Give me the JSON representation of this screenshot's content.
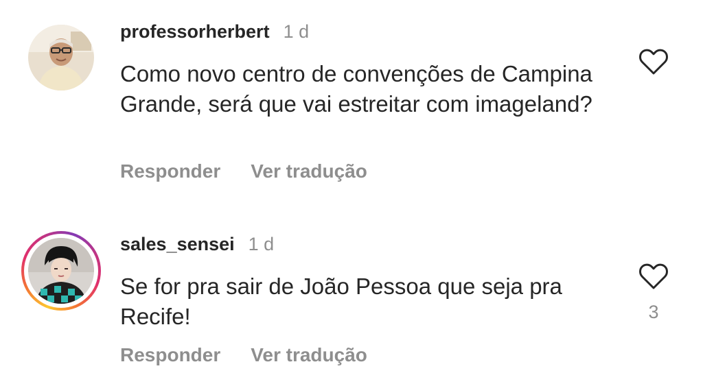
{
  "comments": [
    {
      "username": "professorherbert",
      "time": "1 d",
      "text": "Como novo centro de convenções de Campina Grande, será que vai estreitar com imageland?",
      "actions": {
        "reply": "Responder",
        "translate": "Ver tradução"
      },
      "like_count": "",
      "has_story_ring": false,
      "like_icon": "heart-outline-icon"
    },
    {
      "username": "sales_sensei",
      "time": "1 d",
      "text": "Se for pra sair de João Pessoa que seja pra Recife!",
      "actions": {
        "reply": "Responder",
        "translate": "Ver tradução"
      },
      "like_count": "3",
      "has_story_ring": true,
      "like_icon": "heart-outline-icon"
    }
  ],
  "colors": {
    "primary_text": "#262626",
    "secondary_text": "#8e8e8e",
    "background": "#ffffff",
    "story_ring_gradient": [
      "#fdc830",
      "#f37335",
      "#e1306c",
      "#c13584",
      "#833ab4"
    ]
  }
}
